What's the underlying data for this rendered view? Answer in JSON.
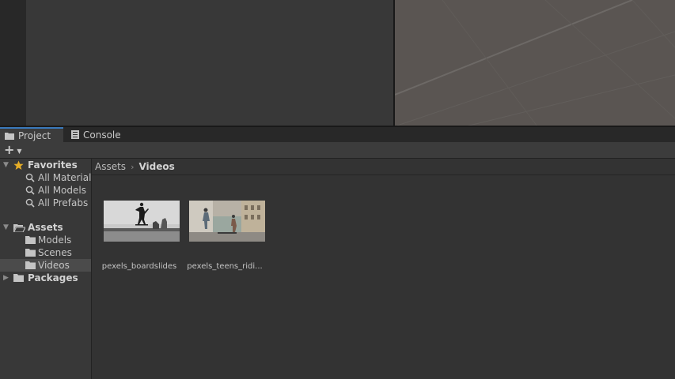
{
  "tabs": [
    {
      "label": "Project",
      "icon": "folder-icon",
      "active": true
    },
    {
      "label": "Console",
      "icon": "console-icon",
      "active": false
    }
  ],
  "toolbar": {
    "add_label": "+",
    "add_icon": "plus-icon"
  },
  "tree": {
    "favorites": {
      "label": "Favorites",
      "items": [
        "All Materials",
        "All Models",
        "All Prefabs"
      ]
    },
    "assets": {
      "label": "Assets",
      "items": [
        "Models",
        "Scenes",
        "Videos"
      ],
      "selected": "Videos"
    },
    "packages": {
      "label": "Packages"
    }
  },
  "breadcrumb": {
    "root": "Assets",
    "separator": "›",
    "current": "Videos"
  },
  "assets": [
    {
      "name": "pexels_boardslides"
    },
    {
      "name": "pexels_teens_ridi..."
    }
  ],
  "colors": {
    "accent": "#3a79bb",
    "favorite_star": "#e5ad27",
    "scene_background": "#5a5552"
  }
}
